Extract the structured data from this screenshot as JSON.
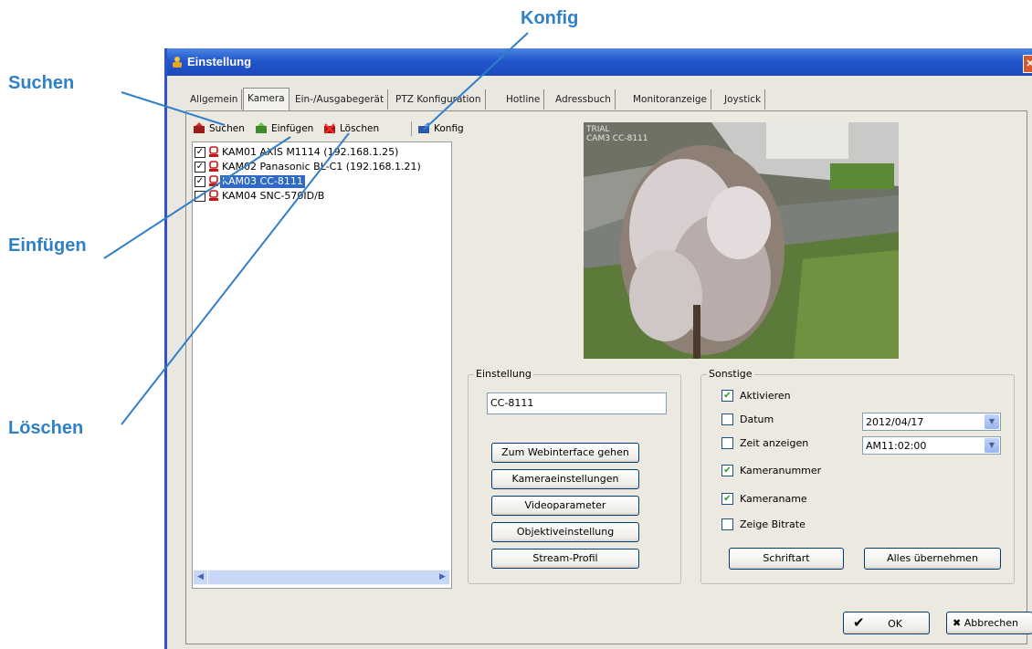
{
  "annotations": {
    "suchen": "Suchen",
    "einfuegen": "Einfügen",
    "loeschen": "Löschen",
    "konfig": "Konfig"
  },
  "window": {
    "title": "Einstellung",
    "close_glyph": "✕"
  },
  "tabs": [
    "Allgemein",
    "Kamera",
    "Ein-/Ausgabegerät",
    "PTZ Konfiguration",
    "Hotline",
    "Adressbuch",
    "Monitoranzeige",
    "Joystick"
  ],
  "toolbar": {
    "search": "Suchen",
    "insert": "Einfügen",
    "delete": "Löschen",
    "config": "Konfig"
  },
  "cameras": [
    {
      "label": "KAM01 AXIS M1114 (192.168.1.25)",
      "checked": true
    },
    {
      "label": "KAM02 Panasonic BL-C1 (192.168.1.21)",
      "checked": true
    },
    {
      "label": "KAM03 CC-8111",
      "checked": true
    },
    {
      "label": "KAM04 SNC-570ID/B",
      "checked": false
    }
  ],
  "preview": {
    "osd_line1": "TRIAL",
    "osd_line2": "CAM3 CC-8111"
  },
  "einstellung": {
    "title": "Einstellung",
    "name_value": "CC-8111",
    "buttons": [
      "Zum Webinterface gehen",
      "Kameraeinstellungen",
      "Videoparameter",
      "Objektiveinstellung",
      "Stream-Profil"
    ]
  },
  "sonstige": {
    "title": "Sonstige",
    "aktivieren": "Aktivieren",
    "datum": "Datum",
    "datum_value": "2012/04/17",
    "zeit": "Zeit anzeigen",
    "zeit_value": "AM11:02:00",
    "kameranummer": "Kameranummer",
    "kameraname": "Kameraname",
    "bitrate": "Zeige Bitrate",
    "schriftart": "Schriftart",
    "alles": "Alles übernehmen",
    "check_glyph": "✔"
  },
  "footer": {
    "ok": "OK",
    "cancel": "Abbrechen",
    "ok_glyph": "✔",
    "cancel_glyph": "✖"
  },
  "colors": {
    "annotation": "#2f80c8",
    "titlebar": "#2256cc",
    "selection": "#316ac5"
  }
}
